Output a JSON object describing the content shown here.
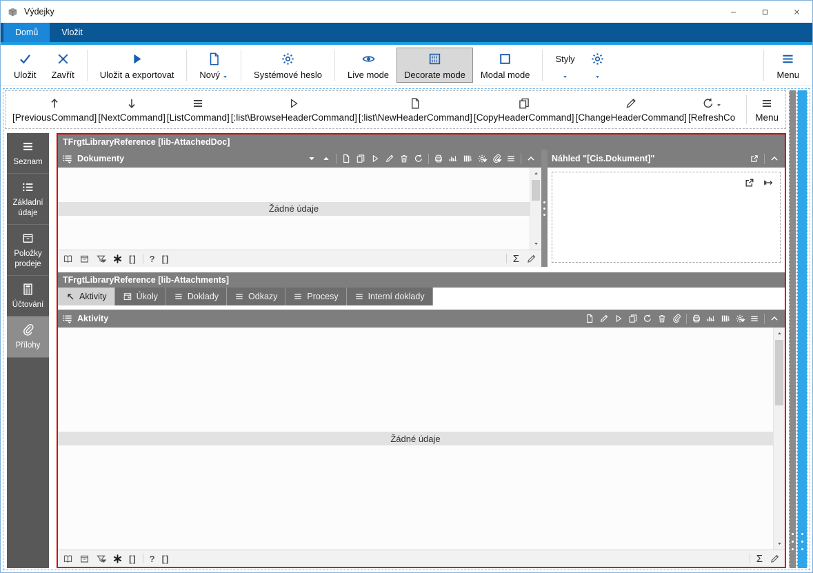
{
  "titlebar": {
    "title": "Výdejky"
  },
  "ribbon_tabs": [
    {
      "name": "domu",
      "label": "Domů",
      "active": true
    },
    {
      "name": "vlozit",
      "label": "Vložit",
      "active": false
    }
  ],
  "toolbar": {
    "menu_label": "Menu",
    "groups": [
      {
        "buttons": [
          {
            "name": "save",
            "icon": "check",
            "label": "Uložit"
          },
          {
            "name": "close",
            "icon": "x",
            "label": "Zavřít"
          }
        ]
      },
      {
        "buttons": [
          {
            "name": "save-and-export",
            "icon": "play-filled",
            "label": "Uložit a exportovat"
          }
        ]
      },
      {
        "buttons": [
          {
            "name": "new",
            "icon": "doc",
            "label": "Nový",
            "dropdown": true
          }
        ]
      },
      {
        "buttons": [
          {
            "name": "system-password",
            "icon": "gear",
            "label": "Systémové heslo"
          }
        ]
      },
      {
        "buttons": [
          {
            "name": "live-mode",
            "icon": "eye",
            "label": "Live mode"
          },
          {
            "name": "decorate-mode",
            "icon": "checker",
            "label": "Decorate mode",
            "selected": true
          },
          {
            "name": "modal-mode",
            "icon": "square",
            "label": "Modal mode"
          }
        ]
      },
      {
        "buttons": [
          {
            "name": "styles",
            "label": "Styly",
            "dropdown": true
          },
          {
            "name": "settings",
            "icon": "gear",
            "dropdown": true
          }
        ]
      }
    ]
  },
  "command_bar": {
    "menu_label": "Menu",
    "items": [
      {
        "name": "previous-command",
        "icon": "up-arrow",
        "label": "[PreviousCommand]"
      },
      {
        "name": "next-command",
        "icon": "down-arrow",
        "label": "[NextCommand]"
      },
      {
        "name": "list-command",
        "icon": "hamburger",
        "label": "[ListCommand]"
      },
      {
        "name": "browse-header-command",
        "icon": "play",
        "label": "[:list\\BrowseHeaderCommand]"
      },
      {
        "name": "new-header-command",
        "icon": "doc",
        "label": "[:list\\NewHeaderCommand]"
      },
      {
        "name": "copy-header-command",
        "icon": "copy",
        "label": "[CopyHeaderCommand]"
      },
      {
        "name": "change-header-command",
        "icon": "pencil",
        "label": "[ChangeHeaderCommand]"
      },
      {
        "name": "refresh-command",
        "icon": "refresh",
        "label": "[RefreshCo",
        "dropdown": true,
        "truncated": true
      }
    ]
  },
  "sidebar": {
    "items": [
      {
        "name": "seznam",
        "icon": "hamburger",
        "label": "Seznam",
        "active": false
      },
      {
        "name": "zakladni-udaje",
        "icon": "list-dots",
        "label": "Základní údaje",
        "active": false
      },
      {
        "name": "polozky-prodeje",
        "icon": "archive-box",
        "label": "Položky prodeje",
        "active": false
      },
      {
        "name": "uctovani",
        "icon": "calculator",
        "label": "Účtování",
        "active": false
      },
      {
        "name": "prilohy",
        "icon": "paperclip",
        "label": "Přílohy",
        "active": true
      }
    ]
  },
  "attached_doc": {
    "frame_title": "TFrgtLibraryReference [lib-AttachedDoc]",
    "dokumenty": {
      "title": "Dokumenty",
      "header_icons": [
        "caret-down",
        "caret-up",
        "sep",
        "doc",
        "copy",
        "play",
        "pencil",
        "trash",
        "refresh",
        "sep",
        "printer",
        "chart",
        "columns",
        "gear-caret",
        "paperclip-caret",
        "hamburger",
        "sep",
        "chevron-up"
      ],
      "empty_text": "Žádné údaje",
      "footer_icons_left": [
        "book",
        "archive-box",
        "filter-caret",
        "asterisk",
        "brackets",
        "sep",
        "question",
        "brackets"
      ],
      "footer_icons_right": [
        "sep",
        "sigma",
        "pencil"
      ]
    },
    "nahled": {
      "title": "Náhled \"[Cis.Dokument]\"",
      "header_icons": [
        "external",
        "sep",
        "chevron-up"
      ],
      "content_icons": [
        "external",
        "resize-h"
      ]
    }
  },
  "attachments": {
    "frame_title": "TFrgtLibraryReference [lib-Attachments]",
    "tabs": [
      {
        "name": "aktivity",
        "icon": "diag-arrow",
        "label": "Aktivity",
        "active": true
      },
      {
        "name": "ukoly",
        "icon": "calendar",
        "label": "Úkoly",
        "active": false
      },
      {
        "name": "doklady",
        "icon": "hamburger",
        "label": "Doklady",
        "active": false
      },
      {
        "name": "odkazy",
        "icon": "hamburger",
        "label": "Odkazy",
        "active": false
      },
      {
        "name": "procesy",
        "icon": "hamburger",
        "label": "Procesy",
        "active": false
      },
      {
        "name": "interni-doklady",
        "icon": "hamburger",
        "label": "Interní doklady",
        "active": false
      }
    ],
    "aktivity_panel": {
      "title": "Aktivity",
      "header_icons": [
        "doc",
        "pencil",
        "play",
        "copy",
        "refresh",
        "trash",
        "paperclip",
        "sep",
        "printer",
        "chart",
        "columns",
        "gear-caret",
        "hamburger",
        "sep",
        "chevron-up"
      ],
      "empty_text": "Žádné údaje",
      "footer_icons_left": [
        "book",
        "archive-box",
        "filter-caret",
        "asterisk",
        "brackets",
        "sep",
        "question",
        "brackets"
      ],
      "footer_icons_right": [
        "sep",
        "sigma",
        "pencil"
      ]
    }
  },
  "text_glyphs": {
    "question": "?",
    "brackets": "[]",
    "sigma": "Σ"
  },
  "colors": {
    "ribbon_blue": "#0a5796",
    "active_tab_blue": "#1b87d9",
    "accent_strip_blue": "#1e9de2",
    "toolbar_icon_blue": "#1b5fae",
    "decorate_frame_red": "#d90000",
    "header_gray": "#7e7e7e",
    "sidebar_gray": "#585858",
    "scroll_strip_blue": "#2ea6e9"
  }
}
